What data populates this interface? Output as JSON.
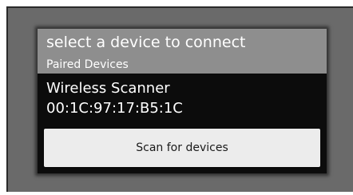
{
  "dialog": {
    "title": "select a device to connect",
    "section_label": "Paired Devices",
    "devices": [
      {
        "name": "Wireless Scanner",
        "address": "00:1C:97:17:B5:1C"
      }
    ],
    "scan_button_label": "Scan for devices"
  },
  "colors": {
    "frame_background": "#6a6a6a",
    "dialog_background": "#0c0c0c",
    "header_background": "#8e8e8e",
    "button_background": "#ececec"
  }
}
